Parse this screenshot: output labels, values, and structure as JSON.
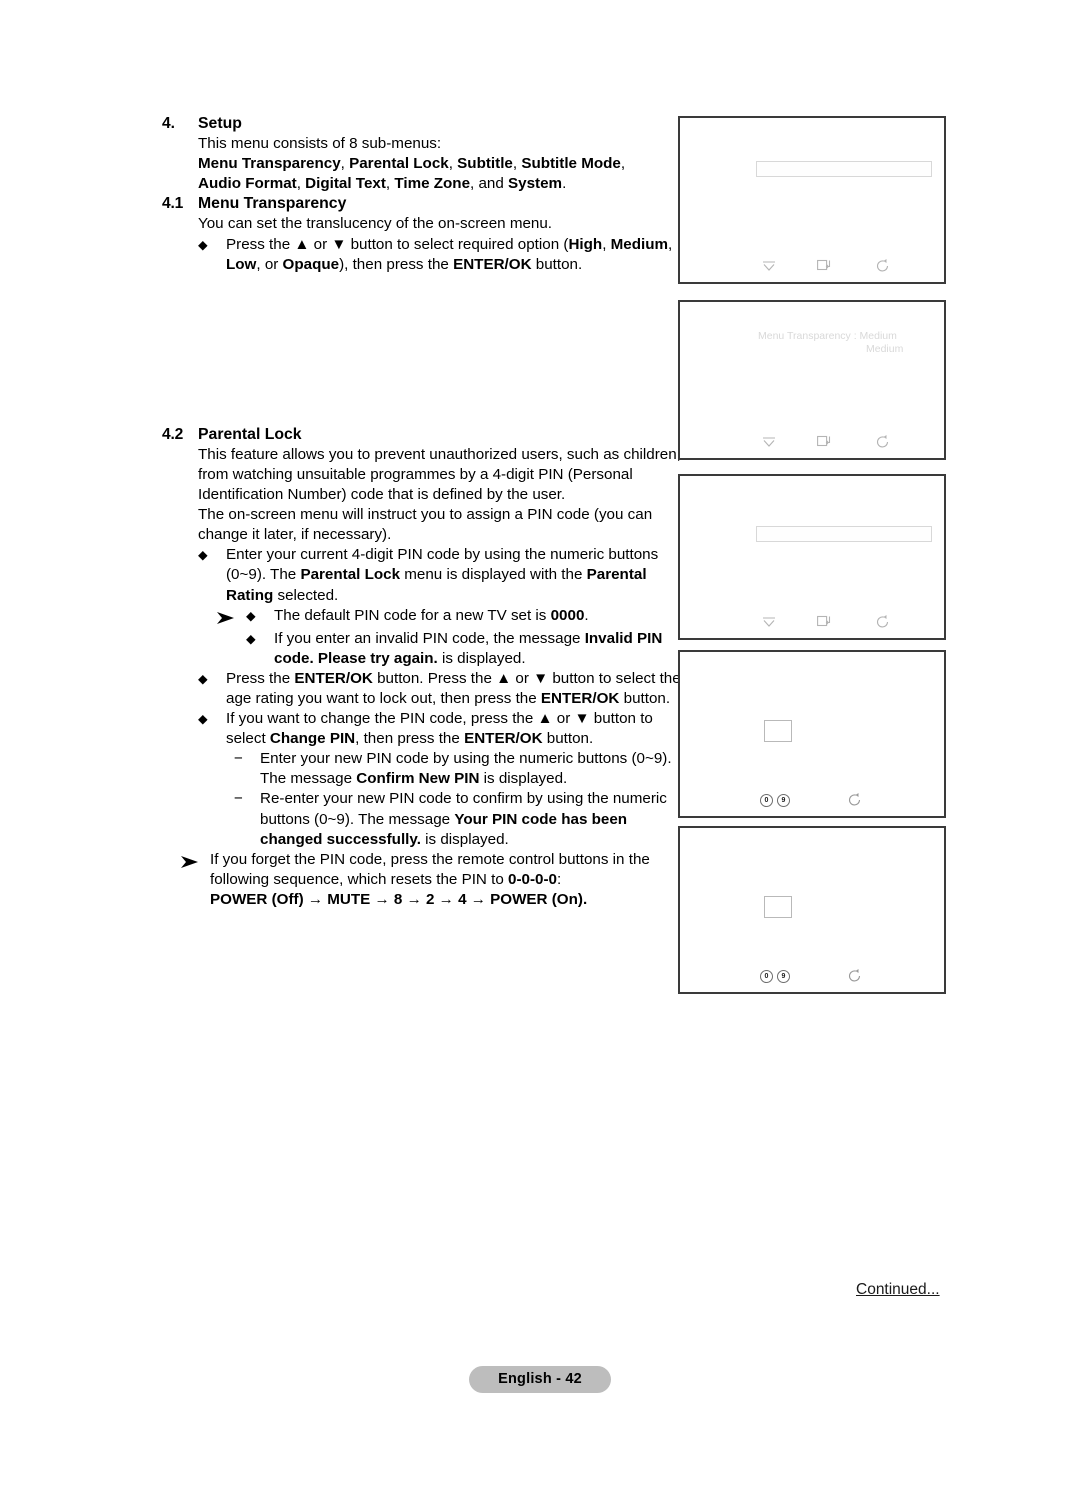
{
  "document": {
    "page_footer": "English - 42",
    "continued": "Continued..."
  },
  "sections": [
    {
      "number": "4.",
      "title": "Setup",
      "intro": "This menu consists of 8 sub-menus:",
      "submenu_line1_parts": [
        {
          "t": "Menu Transparency",
          "b": true
        },
        {
          "t": ", ",
          "b": false
        },
        {
          "t": "Parental Lock",
          "b": true
        },
        {
          "t": ", ",
          "b": false
        },
        {
          "t": "Subtitle",
          "b": true
        },
        {
          "t": ", ",
          "b": false
        },
        {
          "t": "Subtitle Mode",
          "b": true
        },
        {
          "t": ",",
          "b": false
        }
      ],
      "submenu_line2_parts": [
        {
          "t": "Audio Format",
          "b": true
        },
        {
          "t": ", ",
          "b": false
        },
        {
          "t": "Digital Text",
          "b": true
        },
        {
          "t": ", ",
          "b": false
        },
        {
          "t": "Time Zone",
          "b": true
        },
        {
          "t": ", and ",
          "b": false
        },
        {
          "t": "System",
          "b": true
        },
        {
          "t": ".",
          "b": false
        }
      ]
    },
    {
      "number": "4.1",
      "title": "Menu Transparency",
      "intro": "You can set the translucency of the on-screen menu.",
      "bullet1_parts": [
        {
          "t": "Press the ▲ or ▼ button to select required option (",
          "b": false
        },
        {
          "t": "High",
          "b": true
        },
        {
          "t": ", ",
          "b": false
        },
        {
          "t": "Medium",
          "b": true
        },
        {
          "t": ", ",
          "b": false
        },
        {
          "t": "Low",
          "b": true
        },
        {
          "t": ", or ",
          "b": false
        },
        {
          "t": "Opaque",
          "b": true
        },
        {
          "t": "), then press the ",
          "b": false
        },
        {
          "t": "ENTER/OK",
          "b": true
        },
        {
          "t": " button.",
          "b": false
        }
      ]
    },
    {
      "number": "4.2",
      "title": "Parental Lock",
      "para1": "This feature allows you to prevent unauthorized users, such as children, from watching unsuitable programmes by a 4-digit PIN (Personal Identification Number) code that is defined by the user.",
      "para2": "The on-screen menu will instruct you to assign a PIN code (you can change it later, if necessary).",
      "bullet_enter_pin_parts": [
        {
          "t": "Enter your current 4-digit PIN code by using the numeric buttons (0~9). The ",
          "b": false
        },
        {
          "t": "Parental Lock",
          "b": true
        },
        {
          "t": " menu is displayed with the ",
          "b": false
        },
        {
          "t": "Parental Rating",
          "b": true
        },
        {
          "t": " selected.",
          "b": false
        }
      ],
      "note_default_pin_parts": [
        {
          "t": "The default PIN code for a new TV set is ",
          "b": false
        },
        {
          "t": "0000",
          "b": true
        },
        {
          "t": ".",
          "b": false
        }
      ],
      "note_invalid_pin_parts": [
        {
          "t": "If you enter an invalid PIN code, the message ",
          "b": false
        },
        {
          "t": "Invalid PIN code. Please try again.",
          "b": true
        },
        {
          "t": " is displayed.",
          "b": false
        }
      ],
      "bullet_age_rating_parts": [
        {
          "t": "Press the ",
          "b": false
        },
        {
          "t": "ENTER/OK",
          "b": true
        },
        {
          "t": " button. Press the ▲ or ▼ button to select the age rating you want to lock out, then press the ",
          "b": false
        },
        {
          "t": "ENTER/OK",
          "b": true
        },
        {
          "t": " button.",
          "b": false
        }
      ],
      "bullet_change_pin_parts": [
        {
          "t": "If you want to change the PIN code, press the ▲ or ▼ button to select ",
          "b": false
        },
        {
          "t": "Change PIN",
          "b": true
        },
        {
          "t": ", then press the ",
          "b": false
        },
        {
          "t": "ENTER/OK",
          "b": true
        },
        {
          "t": " button.",
          "b": false
        }
      ],
      "dash_new_pin_parts": [
        {
          "t": "Enter your new PIN code by using the numeric buttons (0~9). The message ",
          "b": false
        },
        {
          "t": "Confirm New PIN",
          "b": true
        },
        {
          "t": " is displayed.",
          "b": false
        }
      ],
      "dash_reenter_pin_parts": [
        {
          "t": "Re-enter your new PIN code to confirm by using the numeric buttons (0~9). The message ",
          "b": false
        },
        {
          "t": "Your PIN code has been changed successfully.",
          "b": true
        },
        {
          "t": " is displayed.",
          "b": false
        }
      ],
      "note_forgot_pin_parts": [
        {
          "t": "If you forget the PIN code, press the remote control buttons in the following sequence, which resets the PIN to ",
          "b": false
        },
        {
          "t": "0-0-0-0",
          "b": true
        },
        {
          "t": ":",
          "b": false
        }
      ],
      "reset_sequence": "POWER (Off) → MUTE → 8 → 2 → 4 → POWER (On)."
    }
  ],
  "screenshots": [
    {
      "id": "setup-menu-shot",
      "kind": "highlight-bar",
      "osd_lines": [],
      "nav_icons": [
        "move-chevron-icon",
        "enter-key-icon",
        "return-arrow-icon"
      ]
    },
    {
      "id": "menu-transparency-shot",
      "kind": "osd-text",
      "osd_lines": [
        "Menu Transparency : Medium",
        "Medium"
      ],
      "nav_icons": [
        "move-chevron-icon",
        "enter-key-icon",
        "return-arrow-icon"
      ]
    },
    {
      "id": "parental-lock-shot",
      "kind": "highlight-bar",
      "osd_lines": [],
      "nav_icons": [
        "move-chevron-icon",
        "enter-key-icon",
        "return-arrow-icon"
      ]
    },
    {
      "id": "pin-entry-shot",
      "kind": "pin-box",
      "osd_lines": [],
      "num_keys": [
        "0",
        "9"
      ],
      "nav_icons": [
        "number-key-0-icon",
        "number-key-9-icon",
        "return-arrow-icon"
      ]
    },
    {
      "id": "confirm-pin-shot",
      "kind": "pin-box",
      "osd_lines": [],
      "num_keys": [
        "0",
        "9"
      ],
      "nav_icons": [
        "number-key-0-icon",
        "number-key-9-icon",
        "return-arrow-icon"
      ]
    }
  ]
}
